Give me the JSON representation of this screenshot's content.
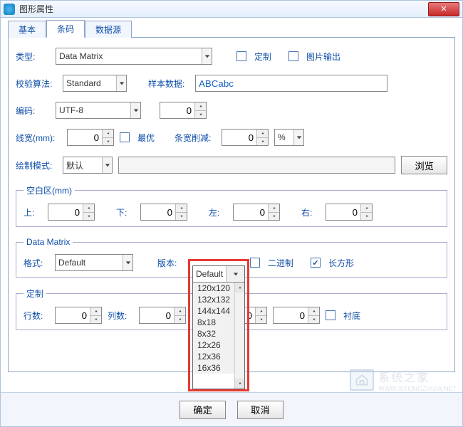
{
  "window": {
    "title": "图形属性",
    "close_glyph": "✕"
  },
  "tabs": {
    "items": [
      "基本",
      "条码",
      "数据源"
    ],
    "active_index": 1
  },
  "type": {
    "label": "类型:",
    "value": "Data Matrix"
  },
  "custom_chk": {
    "label": "定制",
    "checked": false
  },
  "image_output_chk": {
    "label": "图片输出",
    "checked": false
  },
  "check_algo": {
    "label": "校验算法:",
    "value": "Standard"
  },
  "sample_data": {
    "label": "样本数据:",
    "value": "ABCabc"
  },
  "encoding": {
    "label": "编码:",
    "value": "UTF-8"
  },
  "encoding_spin": {
    "value": "0"
  },
  "line_width": {
    "label": "线宽(mm):",
    "value": "0"
  },
  "optimal_chk": {
    "label": "最优",
    "checked": false
  },
  "bar_reduce": {
    "label": "条宽削减:",
    "value": "0",
    "unit": "%"
  },
  "draw_mode": {
    "label": "绘制模式:",
    "value": "默认"
  },
  "draw_path": {
    "value": ""
  },
  "browse_btn": {
    "label": "浏览"
  },
  "quiet_zone": {
    "legend": "空白区(mm)",
    "top": {
      "label": "上:",
      "value": "0"
    },
    "bottom": {
      "label": "下:",
      "value": "0"
    },
    "left": {
      "label": "左:",
      "value": "0"
    },
    "right": {
      "label": "右:",
      "value": "0"
    }
  },
  "data_matrix": {
    "legend": "Data Matrix",
    "format": {
      "label": "格式:",
      "value": "Default"
    },
    "version": {
      "label": "版本:",
      "value": "Default",
      "options": [
        "120x120",
        "132x132",
        "144x144",
        "8x18",
        "8x32",
        "12x26",
        "12x36",
        "16x36"
      ]
    },
    "binary_chk": {
      "label": "二进制",
      "checked": false
    },
    "rect_chk": {
      "label": "长方形",
      "checked": true
    }
  },
  "custom_group": {
    "legend": "定制",
    "rows": {
      "label": "行数:",
      "value": "0"
    },
    "cols": {
      "label": "列数:",
      "value": "0"
    },
    "extra1": {
      "value": "0"
    },
    "extra2": {
      "value": "0"
    },
    "backing_chk": {
      "label": "衬底",
      "checked": false
    }
  },
  "buttons": {
    "ok": "确定",
    "cancel": "取消"
  },
  "watermark": {
    "title": "系统之家",
    "url": "WWW.XITONGZHIJIA.NET"
  }
}
